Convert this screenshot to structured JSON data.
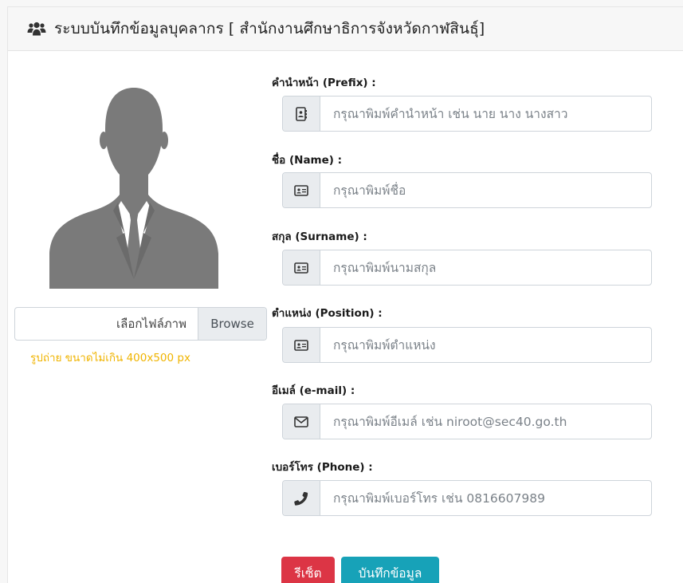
{
  "header": {
    "icon": "users-icon",
    "title": "ระบบบันทึกข้อมูลบุคลากร [ สำนักงานศึกษาธิการจังหวัดกาฬสินธุ์]"
  },
  "photo": {
    "icon": "person-silhouette-icon",
    "file_label": "เลือกไฟล์ภาพ",
    "browse_label": "Browse",
    "note": "รูปถ่าย ขนาดไม่เกิน 400x500 px",
    "note_color": "#f0b400"
  },
  "form": {
    "fields": [
      {
        "label": "คำนำหน้า (Prefix) :",
        "placeholder": "กรุณาพิมพ์คำนำหน้า เช่น นาย นาง นางสาว",
        "value": "",
        "icon": "address-book-icon"
      },
      {
        "label": "ชื่อ (Name) :",
        "placeholder": "กรุณาพิมพ์ชื่อ",
        "value": "",
        "icon": "id-card-icon"
      },
      {
        "label": "สกุล (Surname) :",
        "placeholder": "กรุณาพิมพ์นามสกุล",
        "value": "",
        "icon": "id-card-icon"
      },
      {
        "label": "ตำแหน่ง (Position) :",
        "placeholder": "กรุณาพิมพ์ตำแหน่ง",
        "value": "",
        "icon": "id-card-icon"
      },
      {
        "label": "อีเมล์ (e-mail) :",
        "placeholder": "กรุณาพิมพ์อีเมล์ เช่น niroot@sec40.go.th",
        "value": "",
        "icon": "envelope-icon"
      },
      {
        "label": "เบอร์โทร (Phone) :",
        "placeholder": "กรุณาพิมพ์เบอร์โทร เช่น 0816607989",
        "value": "",
        "icon": "phone-icon"
      }
    ]
  },
  "buttons": {
    "reset_label": "รีเซ็ต",
    "save_label": "บันทึกข้อมูล",
    "reset_color": "#dc3545",
    "save_color": "#17a2b8"
  }
}
